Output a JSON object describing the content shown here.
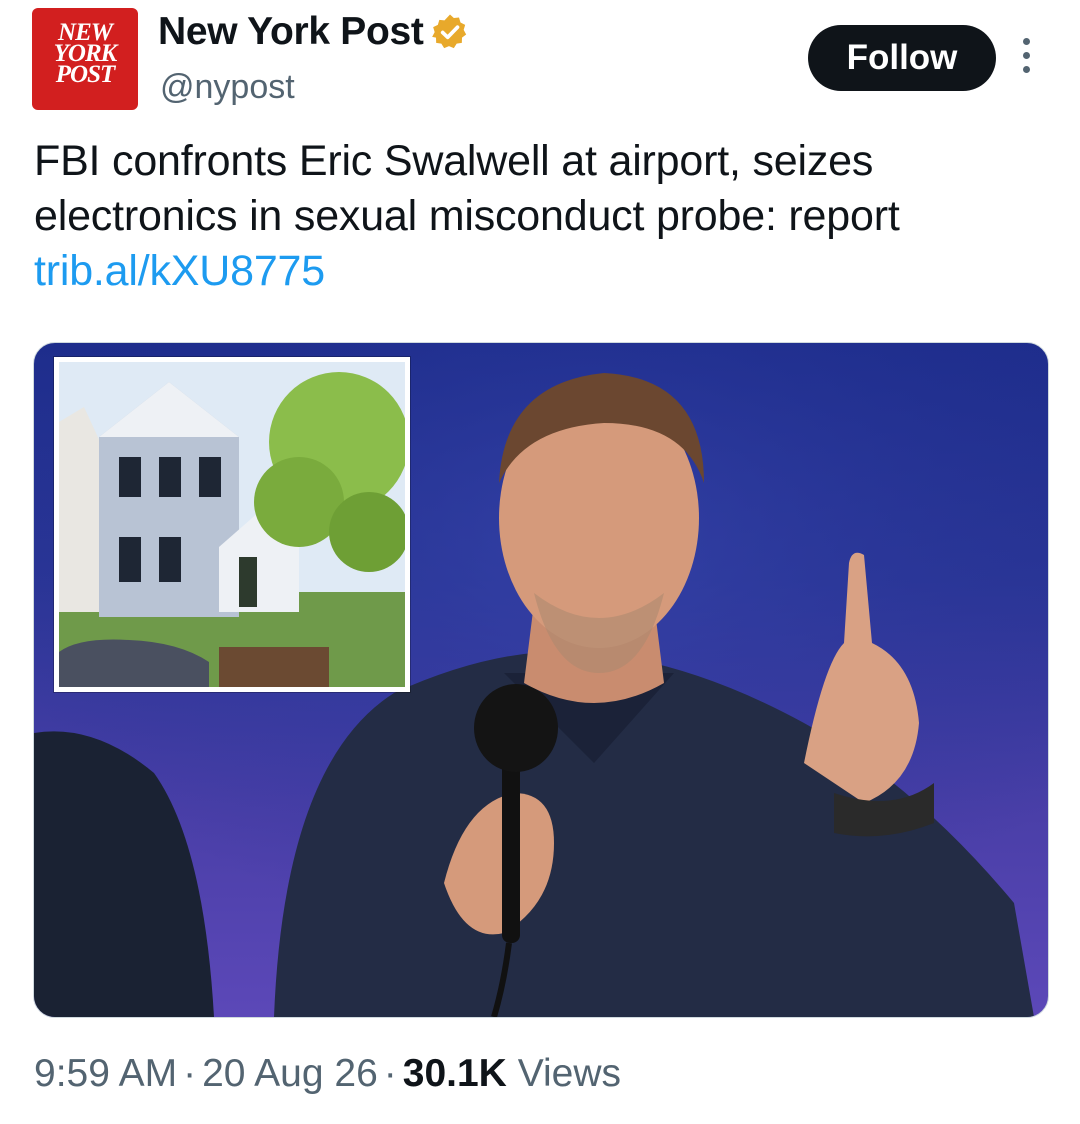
{
  "account": {
    "display_name": "New York Post",
    "handle": "@nypost",
    "verified": true,
    "avatar_logo_lines": [
      "NEW",
      "YORK",
      "POST"
    ],
    "brand_color": "#d21f1f"
  },
  "actions": {
    "follow_label": "Follow",
    "more_icon": "more-vertical-icon"
  },
  "tweet": {
    "text": "FBI confronts Eric Swalwell at airport, seizes electronics in sexual misconduct probe: report",
    "link": "trib.al/kXU8775"
  },
  "media": {
    "type": "photo",
    "inset_photo": "house-photo"
  },
  "meta": {
    "time": "9:59 AM",
    "date": "20 Aug 26",
    "views_count": "30.1K",
    "views_label": "Views",
    "separator": "·"
  },
  "colors": {
    "text": "#0f1419",
    "secondary": "#536471",
    "link": "#1d9bf0",
    "verified_badge": "#e8a92b"
  }
}
